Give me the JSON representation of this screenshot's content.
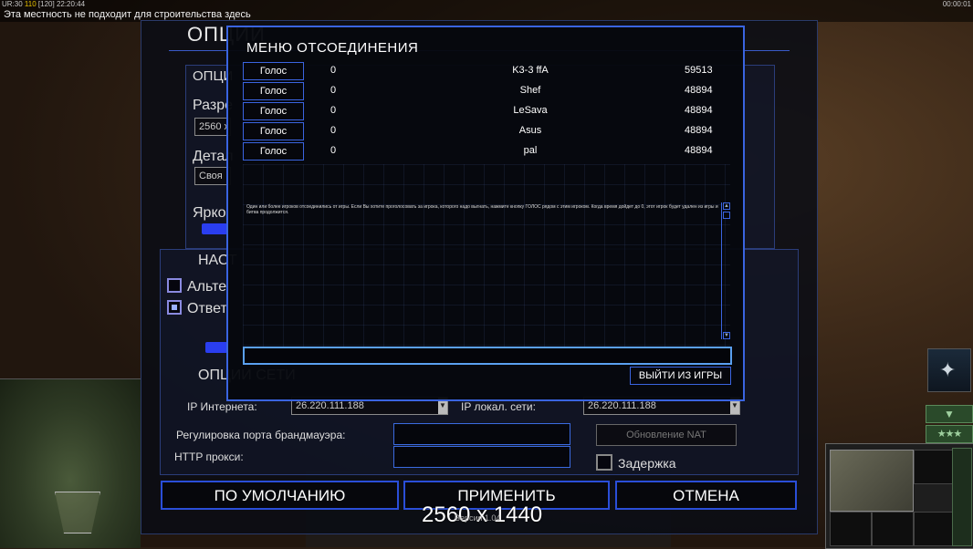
{
  "hud": {
    "stats_prefix": "UR:30",
    "stats_mid": "110",
    "stats_suffix": "[120] 22:20:44",
    "clock": "00:00:01",
    "message": "Эта местность не подходит для строительства здесь"
  },
  "options": {
    "title": "ОПЦИИ",
    "section_display": "ОПЦИ",
    "resolution_label": "Разре",
    "resolution_value": "2560 x",
    "detail_label": "Детал",
    "detail_value": "Своя",
    "brightness_label": "Ярко",
    "control_section": "НАСТ",
    "alt_label": "Альте",
    "reply_label": "Ответ",
    "network_section": "ОПЦИИ СЕТИ",
    "ip_internet_label": "IP Интернета:",
    "ip_internet_value": "26.220.111.188",
    "ip_local_label": "IP локал. сети:",
    "ip_local_value": "26.220.111.188",
    "firewall_label": "Регулировка порта брандмауэра:",
    "proxy_label": "HTTP прокси:",
    "nat_button": "Обновление NAT",
    "delay_label": "Задержка",
    "default_button": "ПО УМОЛЧАНИЮ",
    "apply_button": "ПРИМЕНИТЬ",
    "cancel_button": "ОТМЕНА",
    "resolution_overlay": "2560 x 1440",
    "version": "Версия 1.04"
  },
  "disconnect": {
    "title": "МЕНЮ ОТСОЕДИНЕНИЯ",
    "players": [
      {
        "vote": "Голос",
        "count": "0",
        "name": "K3-3 ffA",
        "ping": "59513"
      },
      {
        "vote": "Голос",
        "count": "0",
        "name": "Shef",
        "ping": "48894"
      },
      {
        "vote": "Голос",
        "count": "0",
        "name": "LeSava",
        "ping": "48894"
      },
      {
        "vote": "Голос",
        "count": "0",
        "name": "Asus",
        "ping": "48894"
      },
      {
        "vote": "Голос",
        "count": "0",
        "name": "pal",
        "ping": "48894"
      }
    ],
    "message": "Один или более игроков отсоединились от игры. Если Вы хотите проголосовать за игрока, которого надо выгнать, нажмите кнопку ГОЛОС рядом с этим игроком. Когда время дойдет до 0, этот игрок будет удален из игры и битва продолжится.",
    "quit_button": "ВЫЙТИ ИЗ ИГРЫ"
  },
  "icons": {
    "satellite": "satellite-icon",
    "chevron": "chevron-down-icon",
    "stars": "rank-stars-icon"
  },
  "colors": {
    "accent_blue": "#3a64e0",
    "input_highlight": "#5aa0f0"
  }
}
